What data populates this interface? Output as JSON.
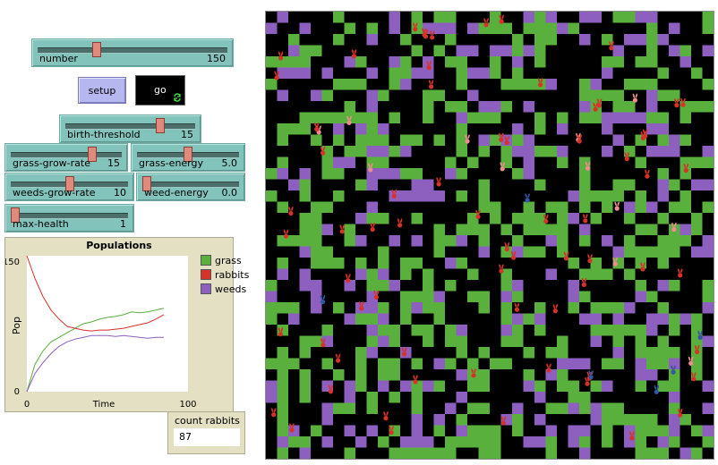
{
  "sliders": {
    "number": {
      "label": "number",
      "value": "150",
      "fraction": 0.3
    },
    "birth_threshold": {
      "label": "birth-threshold",
      "value": "15",
      "fraction": 0.75
    },
    "grass_grow_rate": {
      "label": "grass-grow-rate",
      "value": "15",
      "fraction": 0.75
    },
    "grass_energy": {
      "label": "grass-energy",
      "value": "5.0",
      "fraction": 0.5
    },
    "weeds_grow_rate": {
      "label": "weeds-grow-rate",
      "value": "10",
      "fraction": 0.5
    },
    "weed_energy": {
      "label": "weed-energy",
      "value": "0.0",
      "fraction": 0.0
    },
    "max_health": {
      "label": "max-health",
      "value": "1",
      "fraction": 0.0
    }
  },
  "buttons": {
    "setup_label": "setup",
    "go_label": "go"
  },
  "plot": {
    "title": "Populations",
    "ylabel": "Pop",
    "xlabel": "Time",
    "xmin": "0",
    "xmax": "100",
    "ymin": "0",
    "ymax": "150",
    "legend": [
      {
        "name": "grass",
        "color": "#59b03c"
      },
      {
        "name": "rabbits",
        "color": "#d73229"
      },
      {
        "name": "weeds",
        "color": "#8d5fbf"
      }
    ]
  },
  "monitor": {
    "label": "count rabbits",
    "value": "87"
  },
  "colors": {
    "grass": "#59b03c",
    "weeds": "#8d5fbf",
    "rabbit_red": "#d73229",
    "rabbit_blue": "#3455a4",
    "rabbit_pink": "#f08c8c"
  },
  "chart_data": {
    "type": "line",
    "title": "Populations",
    "xlabel": "Time",
    "ylabel": "Pop",
    "xlim": [
      0,
      100
    ],
    "ylim": [
      0,
      150
    ],
    "x": [
      0,
      5,
      10,
      15,
      20,
      25,
      30,
      35,
      40,
      45,
      50,
      55,
      60,
      65,
      70,
      75,
      80,
      85
    ],
    "series": [
      {
        "name": "grass",
        "values": [
          0,
          30,
          45,
          55,
          60,
          65,
          70,
          75,
          77,
          80,
          82,
          83,
          85,
          88,
          87,
          88,
          90,
          92
        ]
      },
      {
        "name": "rabbits",
        "values": [
          150,
          125,
          105,
          90,
          80,
          72,
          70,
          68,
          67,
          68,
          68,
          69,
          70,
          72,
          74,
          76,
          80,
          85
        ]
      },
      {
        "name": "weeds",
        "values": [
          0,
          20,
          32,
          42,
          50,
          55,
          58,
          60,
          62,
          62,
          62,
          61,
          62,
          61,
          60,
          59,
          60,
          60
        ]
      }
    ]
  }
}
